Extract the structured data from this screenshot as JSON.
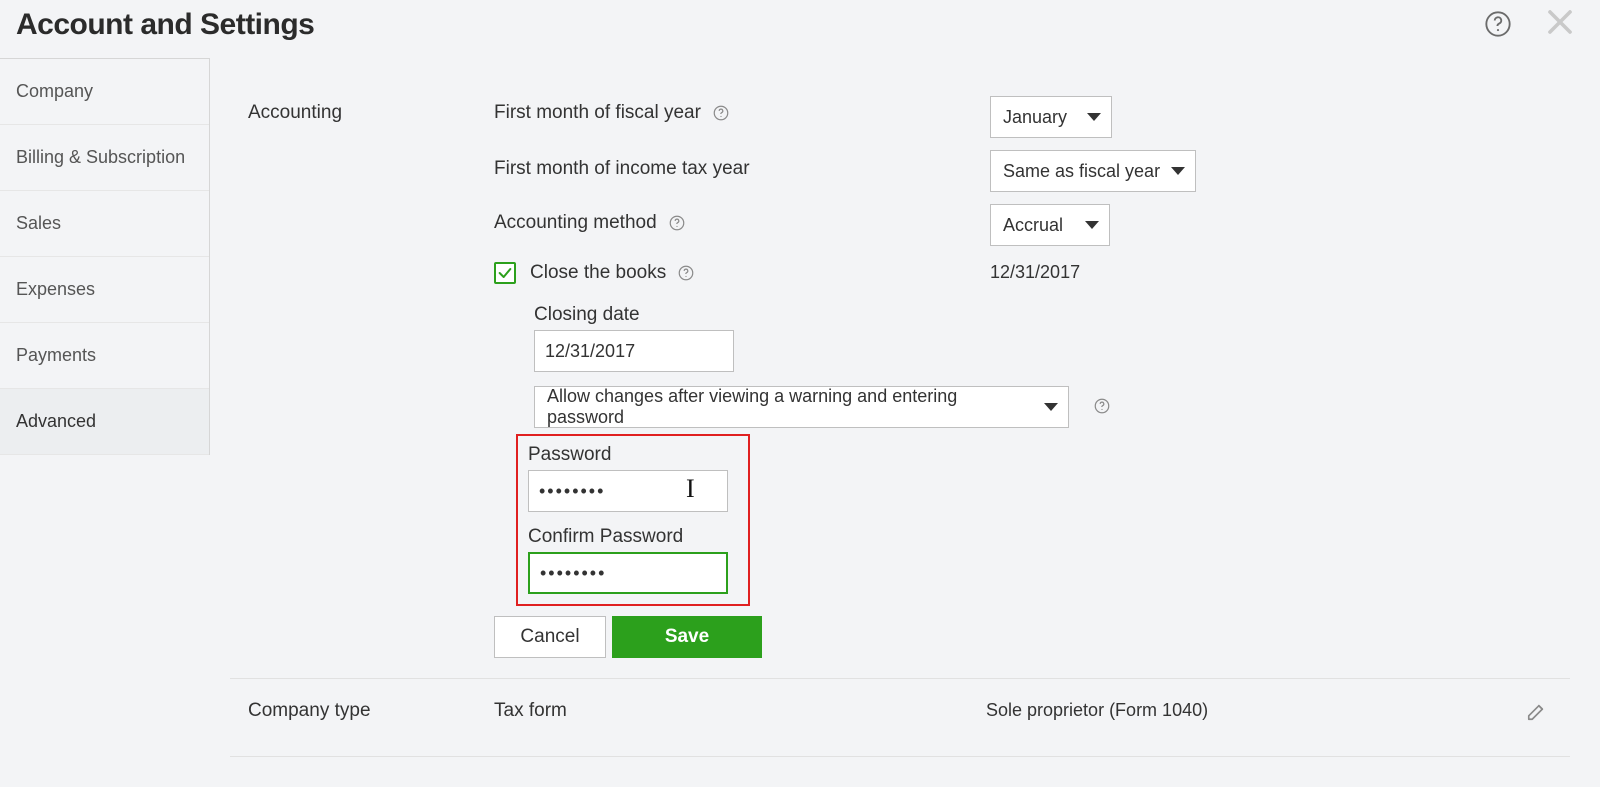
{
  "header": {
    "title": "Account and Settings"
  },
  "sidebar": {
    "items": [
      {
        "label": "Company"
      },
      {
        "label": "Billing & Subscription"
      },
      {
        "label": "Sales"
      },
      {
        "label": "Expenses"
      },
      {
        "label": "Payments"
      },
      {
        "label": "Advanced"
      }
    ],
    "active_index": 5
  },
  "accounting": {
    "section_title": "Accounting",
    "fiscal_year_label": "First month of fiscal year",
    "fiscal_year_value": "January",
    "income_tax_label": "First month of income tax year",
    "income_tax_value": "Same as fiscal year",
    "method_label": "Accounting method",
    "method_value": "Accrual",
    "close_books_label": "Close the books",
    "close_books_checked": true,
    "close_books_date_display": "12/31/2017",
    "closing_date_label": "Closing date",
    "closing_date_value": "12/31/2017",
    "policy_value": "Allow changes after viewing a warning and entering password",
    "password_label": "Password",
    "password_value": "••••••••",
    "confirm_password_label": "Confirm Password",
    "confirm_password_value": "••••••••",
    "cancel_label": "Cancel",
    "save_label": "Save"
  },
  "company_type": {
    "section_title": "Company type",
    "field_label": "Tax form",
    "field_value": "Sole proprietor (Form 1040)"
  }
}
